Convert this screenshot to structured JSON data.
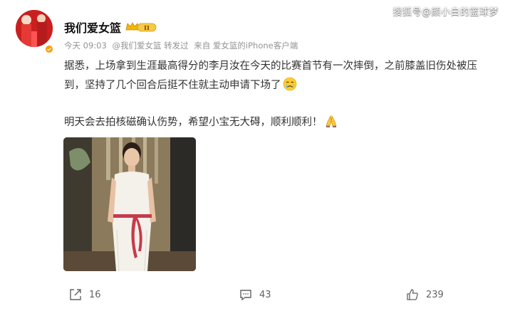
{
  "watermark": "搜狐号@颜小白的篮球梦",
  "post": {
    "author": "我们爱女篮",
    "member_level": "II",
    "meta": {
      "time": "今天 09:03",
      "reposted_from": "@我们爱女篮 转发过",
      "source": "来自 爱女篮的iPhone客户端"
    },
    "paragraphs": [
      "据悉，上场拿到生涯最高得分的李月汝在今天的比赛首节有一次摔倒，之前膝盖旧伤处被压到，坚持了几个回合后挺不住就主动申请下场了",
      "明天会去拍核磁确认伤势，希望小宝无大碍，顺利顺利！"
    ],
    "emoji": [
      "crying-face",
      "folded-hands"
    ],
    "image_alt": "photo of a woman in a white dress"
  },
  "actions": {
    "repost_count": "16",
    "comment_count": "43",
    "like_count": "239"
  },
  "colors": {
    "badge_orange": "#ff9b00",
    "avatar_red": "#d92a2a",
    "meta_gray": "#939393"
  }
}
